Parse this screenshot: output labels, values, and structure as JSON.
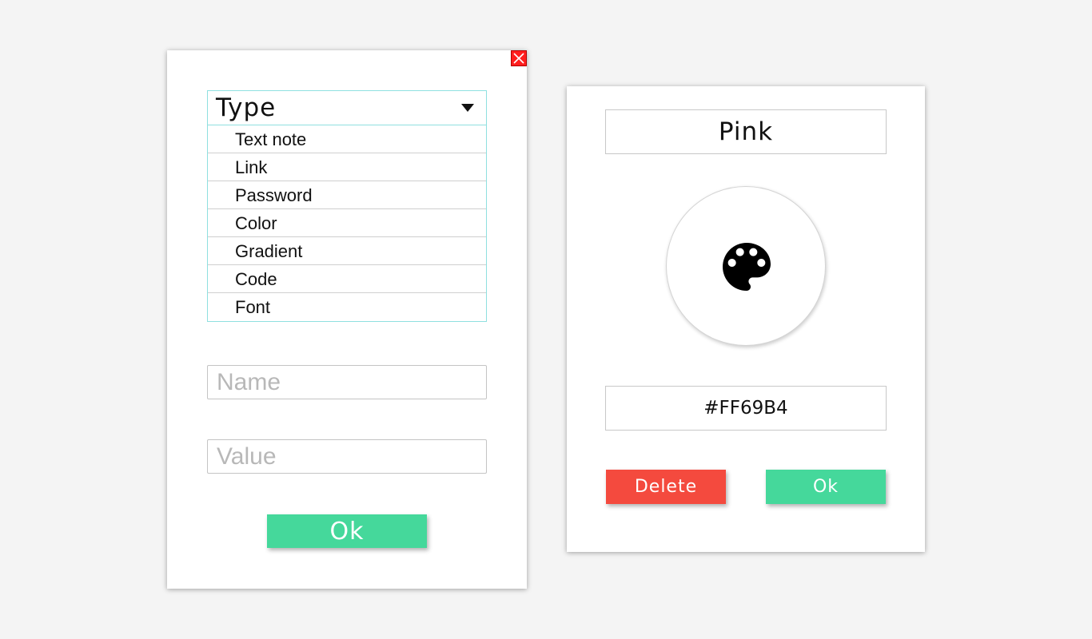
{
  "type_dialog": {
    "type_label": "Type",
    "options": [
      "Text note",
      "Link",
      "Password",
      "Color",
      "Gradient",
      "Code",
      "Font"
    ],
    "name_placeholder": "Name",
    "value_placeholder": "Value",
    "ok_label": "Ok"
  },
  "color_dialog": {
    "color_name": "Pink",
    "hex_value": "#FF69B4",
    "delete_label": "Delete",
    "ok_label": "Ok"
  },
  "icons": {
    "close": "close-icon",
    "dropdown": "caret-down-icon",
    "palette": "palette-icon"
  },
  "colors": {
    "background": "#f4f4f4",
    "close_button": "#ff1e1e",
    "ok_button": "#45d89b",
    "delete_button": "#f44a3e",
    "dropdown_border": "#8fe0e0"
  }
}
